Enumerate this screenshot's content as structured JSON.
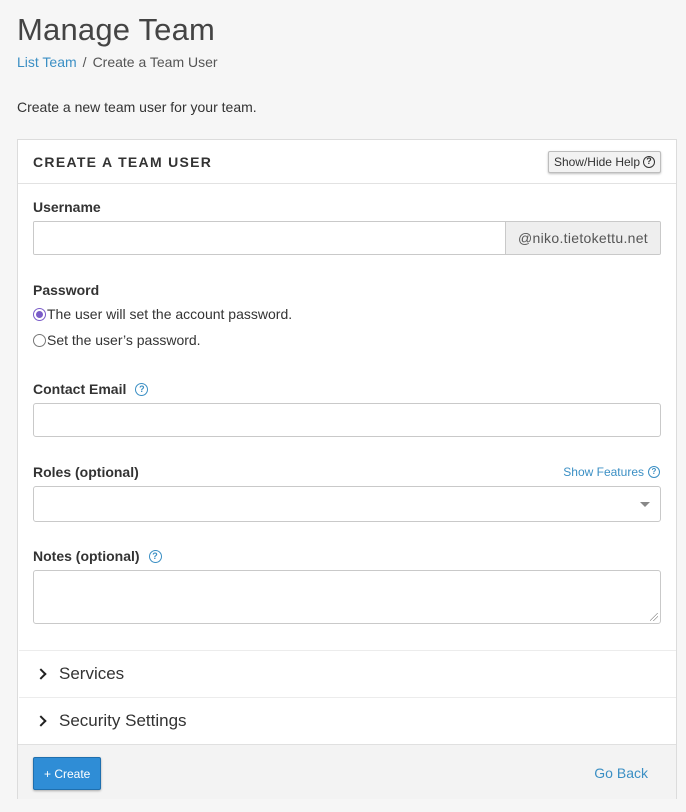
{
  "page": {
    "title": "Manage Team",
    "intro": "Create a new team user for your team."
  },
  "breadcrumb": {
    "link": "List Team",
    "separator": "/",
    "current": "Create a Team User"
  },
  "panel": {
    "title": "CREATE A TEAM USER",
    "help_toggle_label": "Show/Hide Help",
    "help_icon": "question-circle-icon"
  },
  "form": {
    "username": {
      "label": "Username",
      "value": "",
      "domain_suffix": "@niko.tietokettu.net"
    },
    "password": {
      "label": "Password",
      "options": [
        {
          "label": "The user will set the account password.",
          "checked": true
        },
        {
          "label": "Set the user’s password.",
          "checked": false
        }
      ]
    },
    "contact_email": {
      "label": "Contact Email",
      "value": ""
    },
    "roles": {
      "label": "Roles (optional)",
      "show_features_label": "Show Features",
      "selected": ""
    },
    "notes": {
      "label": "Notes (optional)",
      "value": ""
    }
  },
  "sections": [
    {
      "label": "Services",
      "expanded": false
    },
    {
      "label": "Security Settings",
      "expanded": false
    }
  ],
  "footer": {
    "create_label": "+ Create",
    "go_back_label": "Go Back"
  },
  "colors": {
    "link": "#3b8fc4",
    "primary_button": "#2f8dd6",
    "radio_checked": "#7a5cc8"
  }
}
